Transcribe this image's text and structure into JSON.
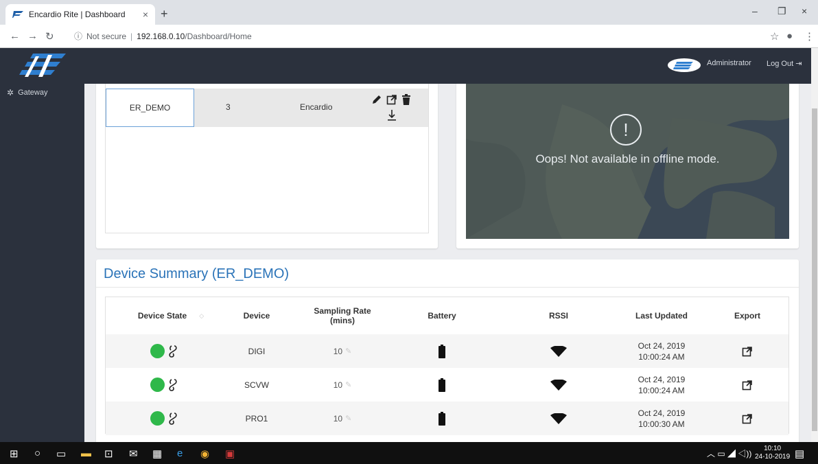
{
  "browser": {
    "tab_title": "Encardio Rite | Dashboard",
    "tab_close": "×",
    "new_tab": "+",
    "security": "Not secure",
    "host": "192.168.0.10",
    "path": "/Dashboard/Home",
    "minimize": "–",
    "restore": "❐",
    "close": "×"
  },
  "header": {
    "user": "Administrator",
    "logout": "Log Out"
  },
  "sidebar": {
    "items": [
      {
        "label": "Gateway",
        "icon": "gear-icon"
      }
    ]
  },
  "gateway_table": {
    "rows": [
      {
        "name": "ER_DEMO",
        "count": "3",
        "owner": "Encardio"
      }
    ]
  },
  "map": {
    "message": "Oops! Not available in offline mode.",
    "alert": "!"
  },
  "summary": {
    "title": "Device Summary (ER_DEMO)",
    "columns": {
      "state": "Device State",
      "device": "Device",
      "rate": "Sampling Rate (mins)",
      "battery": "Battery",
      "rssi": "RSSI",
      "last_updated": "Last Updated",
      "export": "Export"
    },
    "rows": [
      {
        "device": "DIGI",
        "rate": "10",
        "date": "Oct 24, 2019",
        "time": "10:00:24 AM"
      },
      {
        "device": "SCVW",
        "rate": "10",
        "date": "Oct 24, 2019",
        "time": "10:00:24 AM"
      },
      {
        "device": "PRO1",
        "rate": "10",
        "date": "Oct 24, 2019",
        "time": "10:00:30 AM"
      }
    ]
  },
  "taskbar": {
    "time": "10:10",
    "date": "24-10-2019"
  },
  "colors": {
    "header_bg": "#2b313d",
    "accent": "#2a73b8",
    "state_ok": "#2fb84a"
  }
}
